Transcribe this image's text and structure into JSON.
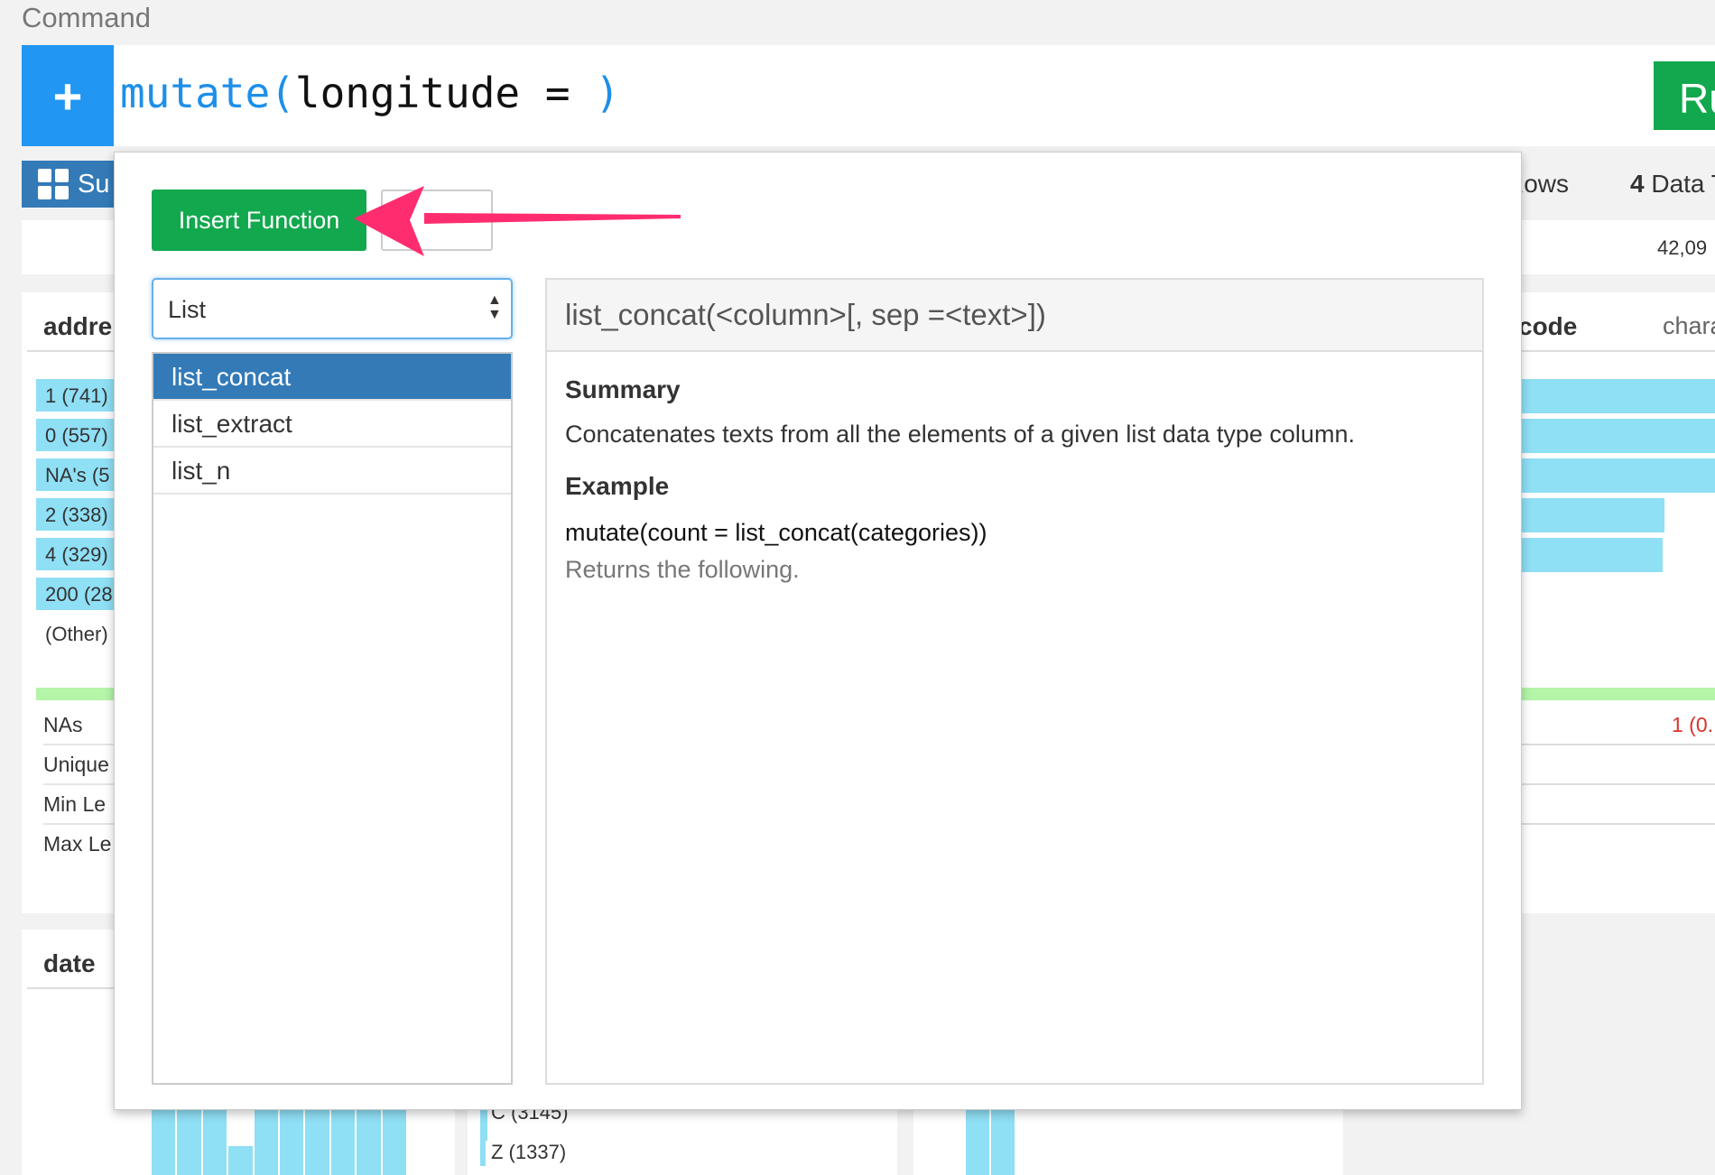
{
  "command": {
    "title": "Command",
    "add_label": "+",
    "text_fn": "mutate(",
    "text_arg": "longitude = ",
    "text_close": ")",
    "run_label": "Ru"
  },
  "summary_tab": {
    "label": "Su"
  },
  "stats_header": {
    "rows_label": "Rows",
    "datatype_count": "4",
    "datatype_label": "Data T",
    "count_value": "42,09"
  },
  "address_card": {
    "header": "addre",
    "bars": [
      "1 (741)",
      "0 (557)",
      "NA's (5",
      "2 (338)",
      "4 (329)",
      "200 (28"
    ],
    "other": "(Other)",
    "stats": [
      "NAs",
      "Unique",
      "Min Le",
      "Max Le"
    ]
  },
  "right_card": {
    "header": "code",
    "type": "chara",
    "paren": ")",
    "na_value": "1 (0."
  },
  "date_card": {
    "header": "date"
  },
  "mid_card": {
    "bar1": "C (3145)",
    "bar2": "Z (1337)"
  },
  "modal": {
    "insert_label": "Insert Function",
    "category_value": "List",
    "functions": [
      "list_concat",
      "list_extract",
      "list_n"
    ],
    "selected_function": "list_concat",
    "doc": {
      "signature": "list_concat(<column>[, sep =<text>])",
      "summary_heading": "Summary",
      "summary_text": "Concatenates texts from all the elements of a given list data type column.",
      "example_heading": "Example",
      "example_code": "mutate(count = list_concat(categories))",
      "example_note": "Returns the following."
    }
  },
  "colors": {
    "primary": "#2196f3",
    "run_green": "#12a84e",
    "selected_blue": "#337ab7",
    "bar_cyan": "#8fdff5",
    "arrow_pink": "#ff2d6f"
  }
}
